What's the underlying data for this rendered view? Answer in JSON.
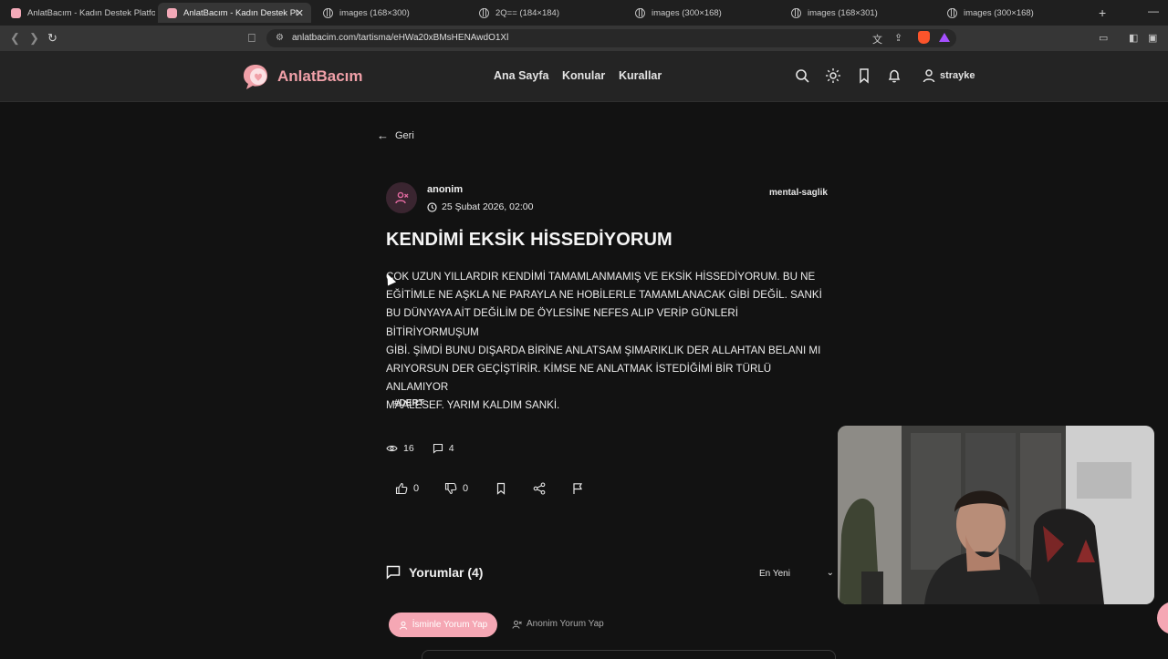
{
  "browser": {
    "tabs": [
      {
        "title": "AnlatBacım - Kadın Destek Platformu",
        "favicon": "pink"
      },
      {
        "title": "AnlatBacım - Kadın Destek Platf",
        "favicon": "pink",
        "active": true
      },
      {
        "title": "images (168×300)",
        "favicon": "globe"
      },
      {
        "title": "2Q== (184×184)",
        "favicon": "globe"
      },
      {
        "title": "images (300×168)",
        "favicon": "globe"
      },
      {
        "title": "images (168×301)",
        "favicon": "globe"
      },
      {
        "title": "images (300×168)",
        "favicon": "globe"
      }
    ],
    "new_tab": "+",
    "url": "anlatbacim.com/tartisma/eHWa20xBMsHENAwdO1Xl"
  },
  "site": {
    "logo": "AnlatBacım",
    "nav": [
      "Ana Sayfa",
      "Konular",
      "Kurallar"
    ],
    "username": "strayke",
    "accent": "#f5a7b4"
  },
  "post": {
    "back_label": "Geri",
    "author": "anonim",
    "date": "25 Şubat 2026, 02:00",
    "category": "mental-saglik",
    "title": "KENDİMİ EKSİK HİSSEDİYORUM",
    "lines": [
      "ÇOK UZUN YILLARDIR KENDİMİ TAMAMLANMAMIŞ VE EKSİK HİSSEDİYORUM. BU NE",
      "EĞİTİMLE NE AŞKLA NE PARAYLA NE HOBİLERLE TAMAMLANACAK GİBİ DEĞİL. SANKİ",
      "BU DÜNYAYA AİT DEĞİLİM DE ÖYLESİNE NEFES ALIP VERİP GÜNLERİ BİTİRİYORMUŞUM",
      "GİBİ. ŞİMDİ BUNU DIŞARDA BİRİNE ANLATSAM ŞIMARIKLIK DER ALLAHTAN BELANI MI",
      "ARIYORSUN DER GEÇİŞTİRİR. KİMSE NE ANLATMAK İSTEDİĞİMİ BİR TÜRLÜ ANLAMIYOR",
      "MAALESEF. YARIM KALDIM SANKİ."
    ],
    "tag": "#DERT",
    "views": "16",
    "comment_count": "4",
    "likes": "0",
    "dislikes": "0"
  },
  "comments": {
    "title": "Yorumlar (4)",
    "sort": "En Yeni",
    "named_button": "İsminle Yorum Yap",
    "anon_button": "Anonim Yorum Yap"
  }
}
